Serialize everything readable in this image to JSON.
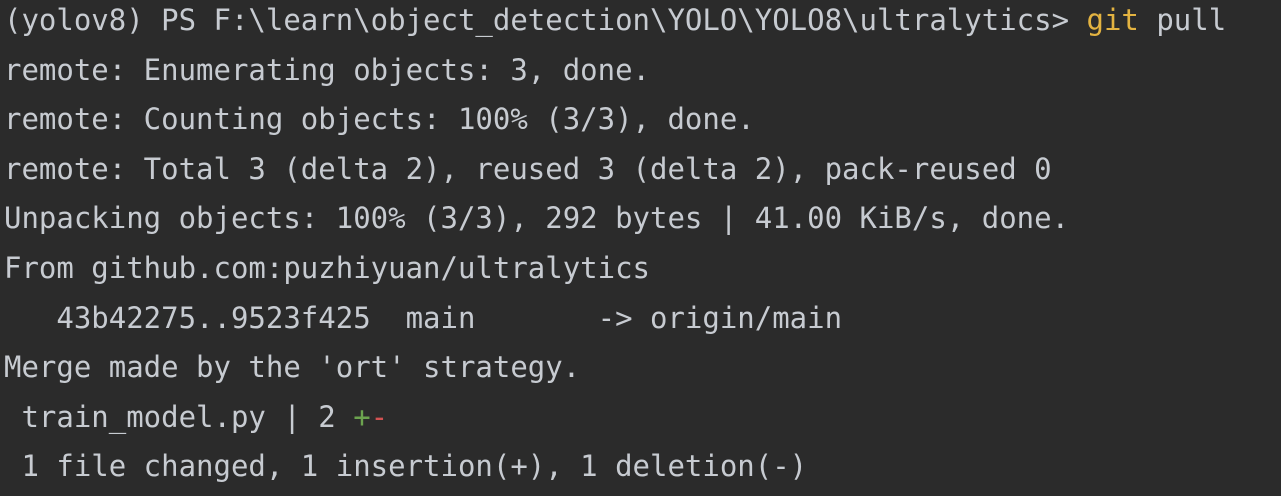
{
  "terminal": {
    "prompt": "(yolov8) PS F:\\learn\\object_detection\\YOLO\\YOLO8\\ultralytics> ",
    "command_git": "git",
    "command_args": " pull",
    "lines": [
      "remote: Enumerating objects: 3, done.",
      "remote: Counting objects: 100% (3/3), done.",
      "remote: Total 3 (delta 2), reused 3 (delta 2), pack-reused 0",
      "Unpacking objects: 100% (3/3), 292 bytes | 41.00 KiB/s, done.",
      "From github.com:puzhiyuan/ultralytics",
      "   43b42275..9523f425  main       -> origin/main",
      "Merge made by the 'ort' strategy."
    ],
    "diffstat": {
      "file": " train_model.py | 2 ",
      "plus": "+",
      "minus": "-"
    },
    "summary": " 1 file changed, 1 insertion(+), 1 deletion(-)"
  },
  "colors": {
    "background": "#2b2b2b",
    "text": "#c7cbd1",
    "command": "#e3b341",
    "insertion": "#6ca34f",
    "deletion": "#d25252"
  }
}
